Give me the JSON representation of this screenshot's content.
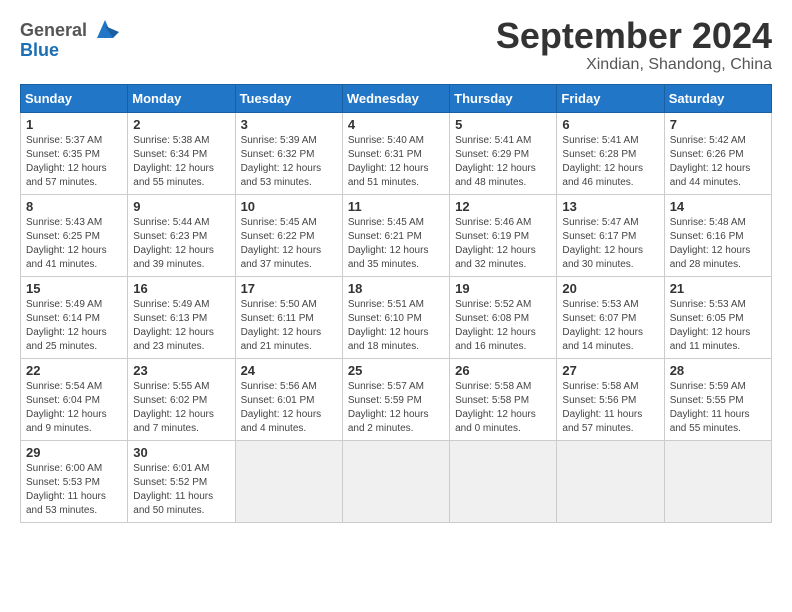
{
  "header": {
    "logo_general": "General",
    "logo_blue": "Blue",
    "month": "September 2024",
    "location": "Xindian, Shandong, China"
  },
  "days_of_week": [
    "Sunday",
    "Monday",
    "Tuesday",
    "Wednesday",
    "Thursday",
    "Friday",
    "Saturday"
  ],
  "weeks": [
    [
      {
        "day": "1",
        "rise": "5:37 AM",
        "set": "6:35 PM",
        "daylight": "12 hours and 57 minutes."
      },
      {
        "day": "2",
        "rise": "5:38 AM",
        "set": "6:34 PM",
        "daylight": "12 hours and 55 minutes."
      },
      {
        "day": "3",
        "rise": "5:39 AM",
        "set": "6:32 PM",
        "daylight": "12 hours and 53 minutes."
      },
      {
        "day": "4",
        "rise": "5:40 AM",
        "set": "6:31 PM",
        "daylight": "12 hours and 51 minutes."
      },
      {
        "day": "5",
        "rise": "5:41 AM",
        "set": "6:29 PM",
        "daylight": "12 hours and 48 minutes."
      },
      {
        "day": "6",
        "rise": "5:41 AM",
        "set": "6:28 PM",
        "daylight": "12 hours and 46 minutes."
      },
      {
        "day": "7",
        "rise": "5:42 AM",
        "set": "6:26 PM",
        "daylight": "12 hours and 44 minutes."
      }
    ],
    [
      {
        "day": "8",
        "rise": "5:43 AM",
        "set": "6:25 PM",
        "daylight": "12 hours and 41 minutes."
      },
      {
        "day": "9",
        "rise": "5:44 AM",
        "set": "6:23 PM",
        "daylight": "12 hours and 39 minutes."
      },
      {
        "day": "10",
        "rise": "5:45 AM",
        "set": "6:22 PM",
        "daylight": "12 hours and 37 minutes."
      },
      {
        "day": "11",
        "rise": "5:45 AM",
        "set": "6:21 PM",
        "daylight": "12 hours and 35 minutes."
      },
      {
        "day": "12",
        "rise": "5:46 AM",
        "set": "6:19 PM",
        "daylight": "12 hours and 32 minutes."
      },
      {
        "day": "13",
        "rise": "5:47 AM",
        "set": "6:17 PM",
        "daylight": "12 hours and 30 minutes."
      },
      {
        "day": "14",
        "rise": "5:48 AM",
        "set": "6:16 PM",
        "daylight": "12 hours and 28 minutes."
      }
    ],
    [
      {
        "day": "15",
        "rise": "5:49 AM",
        "set": "6:14 PM",
        "daylight": "12 hours and 25 minutes."
      },
      {
        "day": "16",
        "rise": "5:49 AM",
        "set": "6:13 PM",
        "daylight": "12 hours and 23 minutes."
      },
      {
        "day": "17",
        "rise": "5:50 AM",
        "set": "6:11 PM",
        "daylight": "12 hours and 21 minutes."
      },
      {
        "day": "18",
        "rise": "5:51 AM",
        "set": "6:10 PM",
        "daylight": "12 hours and 18 minutes."
      },
      {
        "day": "19",
        "rise": "5:52 AM",
        "set": "6:08 PM",
        "daylight": "12 hours and 16 minutes."
      },
      {
        "day": "20",
        "rise": "5:53 AM",
        "set": "6:07 PM",
        "daylight": "12 hours and 14 minutes."
      },
      {
        "day": "21",
        "rise": "5:53 AM",
        "set": "6:05 PM",
        "daylight": "12 hours and 11 minutes."
      }
    ],
    [
      {
        "day": "22",
        "rise": "5:54 AM",
        "set": "6:04 PM",
        "daylight": "12 hours and 9 minutes."
      },
      {
        "day": "23",
        "rise": "5:55 AM",
        "set": "6:02 PM",
        "daylight": "12 hours and 7 minutes."
      },
      {
        "day": "24",
        "rise": "5:56 AM",
        "set": "6:01 PM",
        "daylight": "12 hours and 4 minutes."
      },
      {
        "day": "25",
        "rise": "5:57 AM",
        "set": "5:59 PM",
        "daylight": "12 hours and 2 minutes."
      },
      {
        "day": "26",
        "rise": "5:58 AM",
        "set": "5:58 PM",
        "daylight": "12 hours and 0 minutes."
      },
      {
        "day": "27",
        "rise": "5:58 AM",
        "set": "5:56 PM",
        "daylight": "11 hours and 57 minutes."
      },
      {
        "day": "28",
        "rise": "5:59 AM",
        "set": "5:55 PM",
        "daylight": "11 hours and 55 minutes."
      }
    ],
    [
      {
        "day": "29",
        "rise": "6:00 AM",
        "set": "5:53 PM",
        "daylight": "11 hours and 53 minutes."
      },
      {
        "day": "30",
        "rise": "6:01 AM",
        "set": "5:52 PM",
        "daylight": "11 hours and 50 minutes."
      },
      {
        "day": "",
        "rise": "",
        "set": "",
        "daylight": ""
      },
      {
        "day": "",
        "rise": "",
        "set": "",
        "daylight": ""
      },
      {
        "day": "",
        "rise": "",
        "set": "",
        "daylight": ""
      },
      {
        "day": "",
        "rise": "",
        "set": "",
        "daylight": ""
      },
      {
        "day": "",
        "rise": "",
        "set": "",
        "daylight": ""
      }
    ]
  ],
  "labels": {
    "sunrise": "Sunrise:",
    "sunset": "Sunset:",
    "daylight": "Daylight:"
  }
}
